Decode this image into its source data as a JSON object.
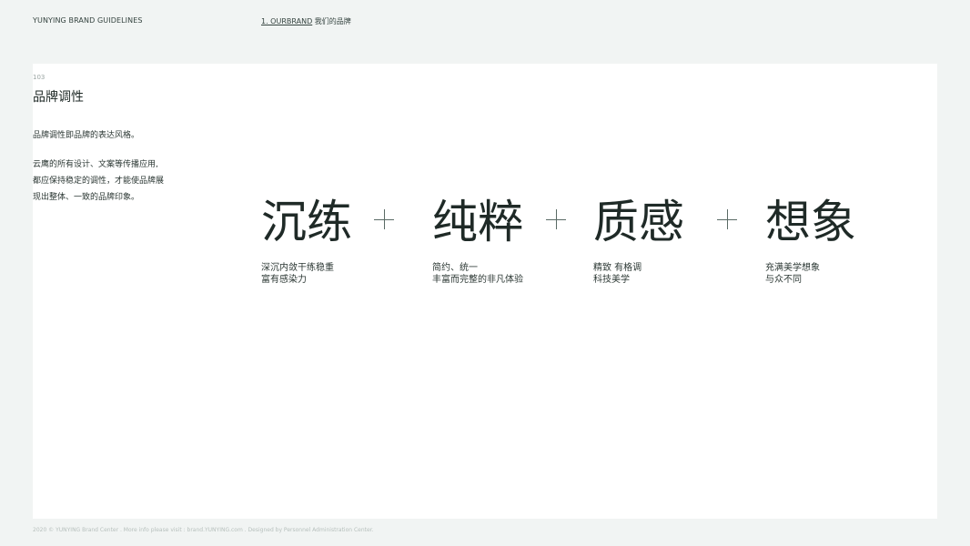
{
  "header": {
    "brand": "YUNYING BRAND GUIDELINES",
    "nav_link": "1. OURBRAND",
    "nav_suffix": " 我们的品牌"
  },
  "section": {
    "page_number": "103",
    "title": "品牌调性",
    "intro": "品牌调性即品牌的表达风格。",
    "description_lines": [
      "云鹰的所有设计、文案等传播应用,",
      "都应保持稳定的调性，才能使品牌展",
      "现出整体、一致的品牌印象。"
    ]
  },
  "traits": [
    {
      "title": "沉练",
      "desc": [
        "深沉内敛干练稳重",
        "富有感染力"
      ]
    },
    {
      "title": "纯粹",
      "desc": [
        "简约、统一",
        "丰富而完整的非凡体验"
      ]
    },
    {
      "title": "质感",
      "desc": [
        "精致 有格调",
        "科技美学"
      ]
    },
    {
      "title": "想象",
      "desc": [
        "充满美学想象",
        "与众不同"
      ]
    }
  ],
  "footer": {
    "text": "2020 © YUNYING Brand Center . More info please visit : brand.YUNYING.com . Designed by Personnel Administration Center."
  }
}
